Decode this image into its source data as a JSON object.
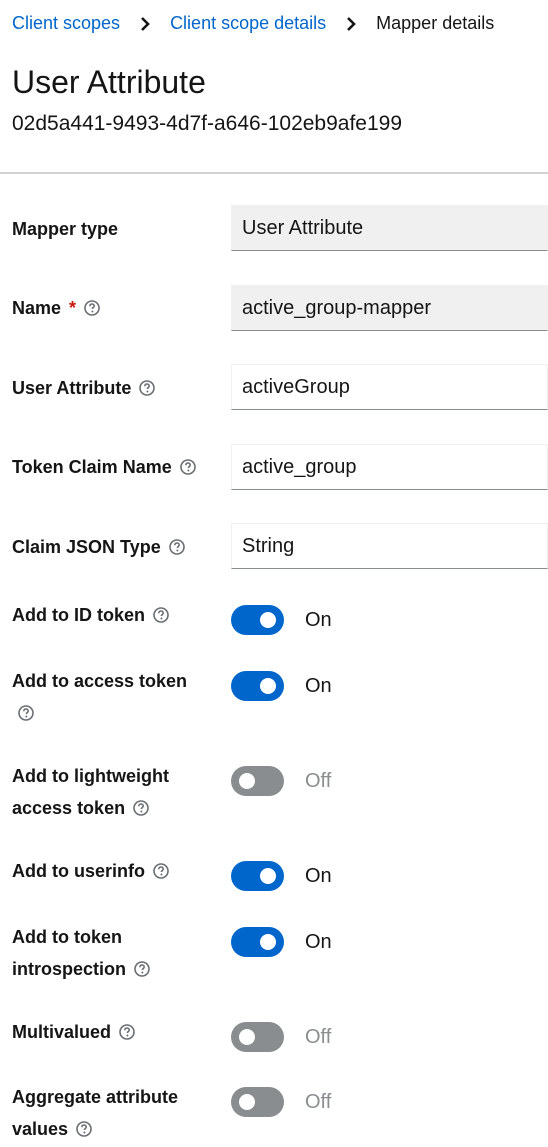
{
  "breadcrumb": {
    "items": [
      "Client scopes",
      "Client scope details",
      "Mapper details"
    ]
  },
  "page": {
    "title": "User Attribute",
    "subtitle": "02d5a441-9493-4d7f-a646-102eb9afe199"
  },
  "form": {
    "mapper_type": {
      "label": "Mapper type",
      "value": "User Attribute"
    },
    "name": {
      "label": "Name",
      "required_mark": "*",
      "value": "active_group-mapper"
    },
    "user_attribute": {
      "label": "User Attribute",
      "value": "activeGroup"
    },
    "token_claim_name": {
      "label": "Token Claim Name",
      "value": "active_group"
    },
    "claim_json_type": {
      "label": "Claim JSON Type",
      "value": "String"
    },
    "toggles": [
      {
        "label_line1": "Add to ID token",
        "label_line2": "",
        "state": "On"
      },
      {
        "label_line1": "Add to access token",
        "label_line2": "",
        "state": "On"
      },
      {
        "label_line1": "Add to lightweight",
        "label_line2": "access token",
        "state": "Off"
      },
      {
        "label_line1": "Add to userinfo",
        "label_line2": "",
        "state": "On"
      },
      {
        "label_line1": "Add to token",
        "label_line2": "introspection",
        "state": "On"
      },
      {
        "label_line1": "Multivalued",
        "label_line2": "",
        "state": "Off"
      },
      {
        "label_line1": "Aggregate attribute",
        "label_line2": "values",
        "state": "Off"
      }
    ]
  },
  "icons": {
    "breadcrumb_separator": "chevron-right-icon",
    "help": "question-circle-icon"
  },
  "colors": {
    "link": "#0066cc",
    "toggle_on": "#0066cc",
    "toggle_off": "#8a8d90",
    "required": "#c9190b"
  }
}
